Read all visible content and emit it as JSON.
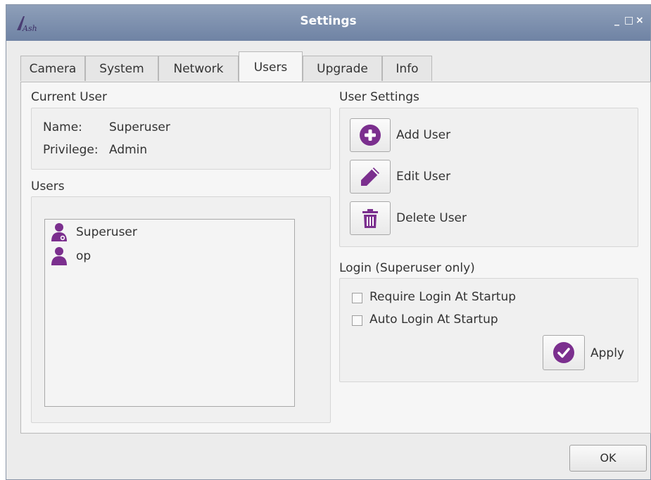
{
  "window": {
    "title": "Settings",
    "logo_text": "Ash",
    "controls": {
      "minimize": "_",
      "maximize": "□",
      "close": "×"
    }
  },
  "tabs": [
    {
      "label": "Camera"
    },
    {
      "label": "System"
    },
    {
      "label": "Network"
    },
    {
      "label": "Users",
      "active": true
    },
    {
      "label": "Upgrade"
    },
    {
      "label": "Info"
    }
  ],
  "current_user": {
    "group_title": "Current User",
    "name_label": "Name:",
    "name_value": "Superuser",
    "privilege_label": "Privilege:",
    "privilege_value": "Admin"
  },
  "users": {
    "group_title": "Users",
    "items": [
      {
        "name": "Superuser",
        "icon": "admin-user-icon"
      },
      {
        "name": "op",
        "icon": "user-icon"
      }
    ]
  },
  "user_settings": {
    "group_title": "User Settings",
    "add_label": "Add User",
    "edit_label": "Edit User",
    "delete_label": "Delete User"
  },
  "login": {
    "group_title": "Login (Superuser only)",
    "require_label": "Require Login At Startup",
    "require_checked": false,
    "auto_label": "Auto Login At Startup",
    "auto_checked": false,
    "apply_label": "Apply"
  },
  "footer": {
    "ok_label": "OK"
  },
  "colors": {
    "accent": "#7b2f8e",
    "titlebar": "#7d90ae"
  }
}
